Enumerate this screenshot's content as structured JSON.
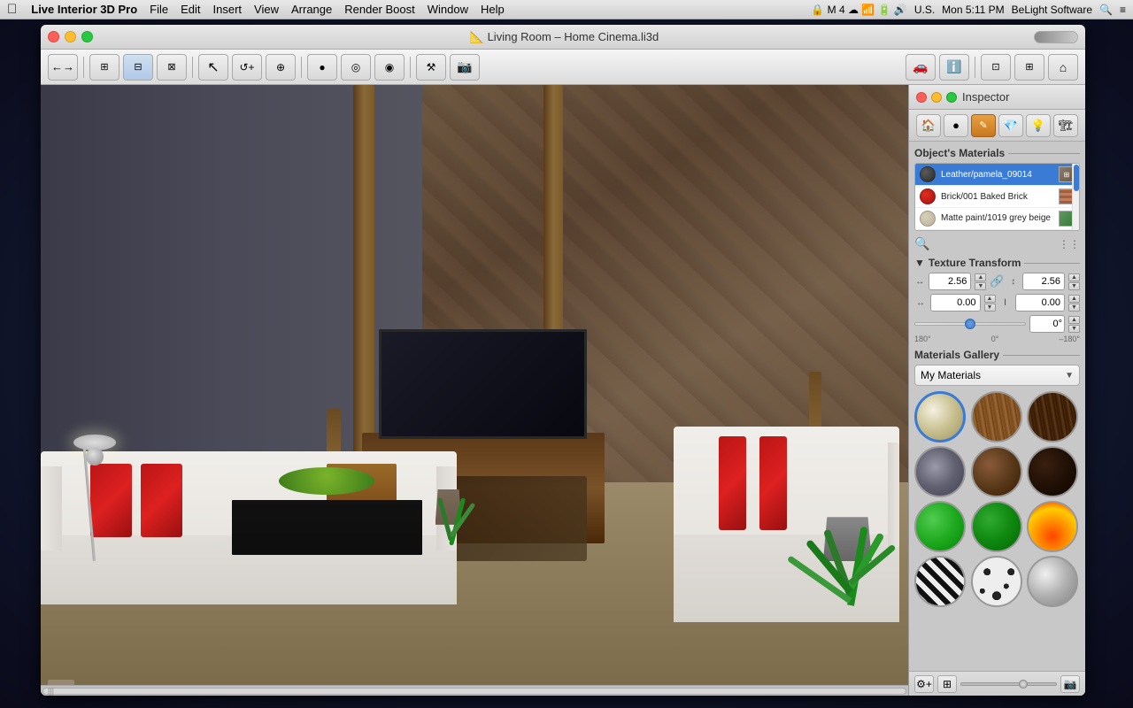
{
  "menubar": {
    "apple": "&#63743;",
    "appName": "Live Interior 3D Pro",
    "menus": [
      "File",
      "Edit",
      "Insert",
      "View",
      "Arrange",
      "Render Boost",
      "Window",
      "Help"
    ],
    "rightItems": [
      "U.S.",
      "Mon 5:11 PM",
      "BeLight Software"
    ]
  },
  "window": {
    "title": "Living Room – Home Cinema.li3d",
    "controls": {
      "close": "close",
      "minimize": "minimize",
      "maximize": "maximize"
    }
  },
  "toolbar": {
    "buttons": [
      "←→",
      "⊞",
      "⊟",
      "⊠",
      "↖",
      "↺",
      "⊕",
      "●",
      "◉",
      "◎",
      "⚒",
      "📷",
      "🚗",
      "ℹ",
      "⊡",
      "⊞",
      "⌂"
    ]
  },
  "inspector": {
    "title": "Inspector",
    "tools": [
      "🏠",
      "●",
      "✎",
      "💎",
      "💡",
      "🏗"
    ],
    "objectsMaterials": {
      "label": "Object's Materials",
      "items": [
        {
          "name": "Leather/pamela_09014",
          "swatchColor": "#3a3a3a",
          "type": "leather"
        },
        {
          "name": "Brick/001 Baked Brick",
          "swatchColor": "#c03020",
          "type": "brick"
        },
        {
          "name": "Matte paint/1019 grey beige",
          "swatchColor": "#c8c090",
          "type": "paint"
        }
      ]
    },
    "textureTransform": {
      "label": "Texture Transform",
      "scaleX": "2.56",
      "scaleY": "2.56",
      "offsetX": "0.00",
      "offsetY": "0.00",
      "angle": "0°",
      "sliderMin": "180°",
      "sliderMid": "0°",
      "sliderMax": "–180°"
    },
    "materialsGallery": {
      "label": "Materials Gallery",
      "dropdown": "My Materials",
      "items": [
        "cream",
        "wood",
        "darkwood",
        "stone",
        "brown",
        "darkbrown",
        "green",
        "darkgreen",
        "fire",
        "zebra",
        "spots",
        "metal"
      ]
    }
  },
  "footer": {
    "sliderValue": 65
  }
}
